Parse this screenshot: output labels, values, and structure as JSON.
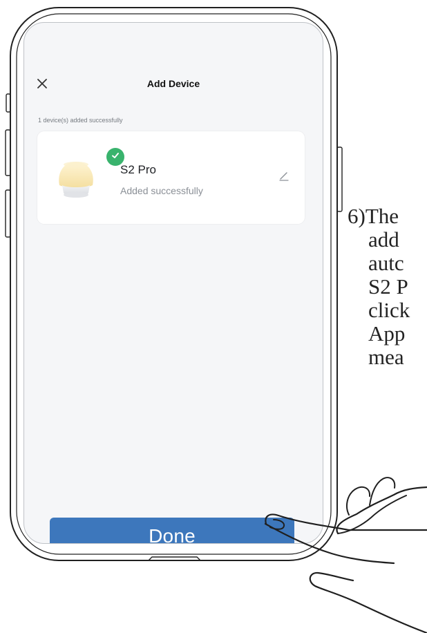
{
  "screen": {
    "title": "Add Device",
    "status_text": "1 device(s) added successfully",
    "device": {
      "name": "S2 Pro",
      "status": "Added successfully"
    },
    "done_label": "Done"
  },
  "instruction": {
    "lines": [
      "6)The",
      "add",
      "autc",
      "S2 P",
      "click",
      "App",
      "mea"
    ]
  },
  "icons": {
    "close": "close-icon",
    "edit": "edit-icon",
    "check": "check-icon",
    "device_image": "lamp-icon"
  },
  "colors": {
    "accent": "#3d77bc",
    "success": "#39b36d",
    "screen_bg": "#f5f6f8"
  }
}
